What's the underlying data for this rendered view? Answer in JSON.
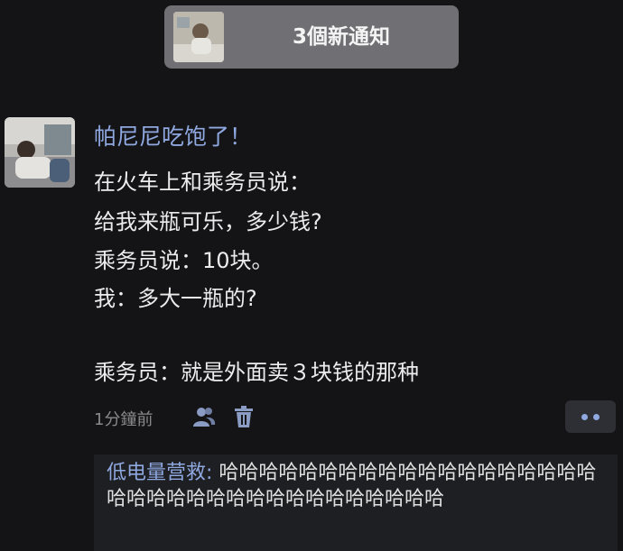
{
  "notification": {
    "text": "3個新通知"
  },
  "post": {
    "username": "帕尼尼吃饱了！",
    "lines": [
      "在火车上和乘务员说：",
      "给我来瓶可乐，多少钱?",
      "乘务员说：10块。",
      "我：多大一瓶的?",
      "乘务员：就是外面卖３块钱的那种"
    ],
    "time": "1分鐘前"
  },
  "actions": {
    "icons": [
      "users-icon",
      "trash-icon",
      "more-icon"
    ]
  },
  "reply": {
    "name": "低电量营救:",
    "text": " 哈哈哈哈哈哈哈哈哈哈哈哈哈哈哈哈哈哈哈哈哈哈哈哈哈哈哈哈哈哈哈哈哈哈哈哈"
  },
  "colors": {
    "background": "#141416",
    "accent": "#8fa8e0",
    "notification_bg": "#707074"
  }
}
